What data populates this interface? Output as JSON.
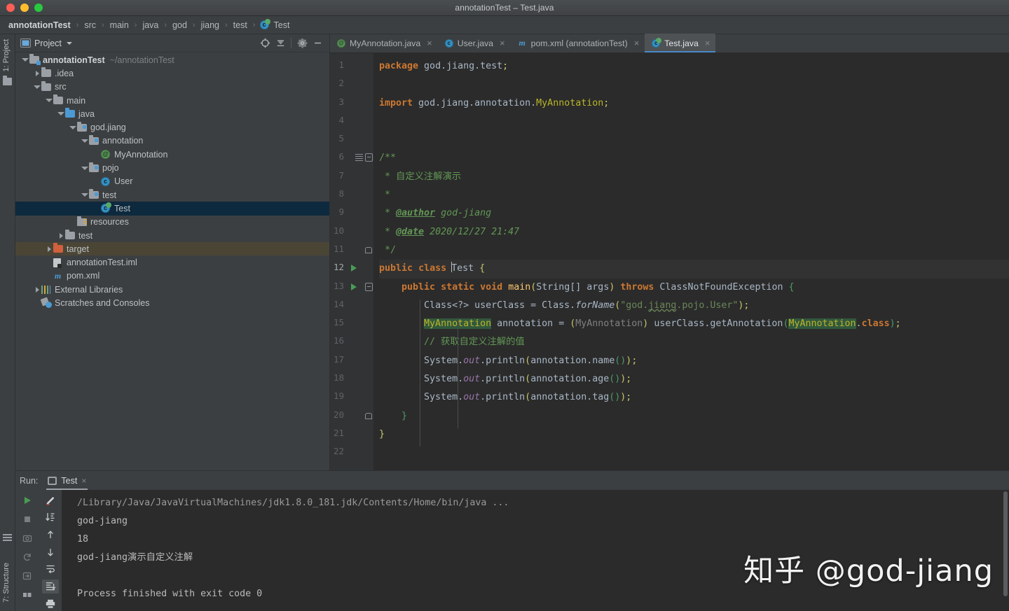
{
  "window": {
    "title": "annotationTest – Test.java",
    "traffic_lights": [
      "close",
      "minimize",
      "zoom"
    ]
  },
  "breadcrumb": {
    "separator": "›",
    "items": [
      {
        "label": "annotationTest",
        "icon": null
      },
      {
        "label": "src",
        "icon": null
      },
      {
        "label": "main",
        "icon": null
      },
      {
        "label": "java",
        "icon": null
      },
      {
        "label": "god",
        "icon": null
      },
      {
        "label": "jiang",
        "icon": null
      },
      {
        "label": "test",
        "icon": null
      },
      {
        "label": "Test",
        "icon": "java-class-icon"
      }
    ]
  },
  "left_strip": {
    "project_label": "1: Project",
    "structure_label": "7: Structure"
  },
  "project_panel": {
    "title": "Project",
    "toolbar": [
      {
        "name": "select-opened-file-button",
        "icon": "crosshair-target-icon"
      },
      {
        "name": "collapse-all-button",
        "icon": "collapse-all-icon"
      },
      {
        "name": "settings-button",
        "icon": "gear-icon"
      },
      {
        "name": "hide-button",
        "icon": "minus-icon"
      }
    ],
    "tree": [
      {
        "label": "annotationTest",
        "sub": "~/annotationTest",
        "depth": 0,
        "arrow": "open",
        "icon": "module-folder-icon",
        "bold": true,
        "state": "normal"
      },
      {
        "label": ".idea",
        "sub": "",
        "depth": 1,
        "arrow": "closed",
        "icon": "folder-icon",
        "bold": false,
        "state": "normal"
      },
      {
        "label": "src",
        "sub": "",
        "depth": 1,
        "arrow": "open",
        "icon": "folder-icon",
        "bold": false,
        "state": "normal"
      },
      {
        "label": "main",
        "sub": "",
        "depth": 2,
        "arrow": "open",
        "icon": "folder-icon",
        "bold": false,
        "state": "normal"
      },
      {
        "label": "java",
        "sub": "",
        "depth": 3,
        "arrow": "open",
        "icon": "source-folder-icon",
        "bold": false,
        "state": "normal"
      },
      {
        "label": "god.jiang",
        "sub": "",
        "depth": 4,
        "arrow": "open",
        "icon": "package-icon",
        "bold": false,
        "state": "normal"
      },
      {
        "label": "annotation",
        "sub": "",
        "depth": 5,
        "arrow": "open",
        "icon": "package-icon",
        "bold": false,
        "state": "normal"
      },
      {
        "label": "MyAnnotation",
        "sub": "",
        "depth": 6,
        "arrow": "none",
        "icon": "annotation-class-icon",
        "bold": false,
        "state": "normal"
      },
      {
        "label": "pojo",
        "sub": "",
        "depth": 5,
        "arrow": "open",
        "icon": "package-icon",
        "bold": false,
        "state": "normal"
      },
      {
        "label": "User",
        "sub": "",
        "depth": 6,
        "arrow": "none",
        "icon": "java-class-icon",
        "bold": false,
        "state": "normal"
      },
      {
        "label": "test",
        "sub": "",
        "depth": 5,
        "arrow": "open",
        "icon": "package-icon",
        "bold": false,
        "state": "normal"
      },
      {
        "label": "Test",
        "sub": "",
        "depth": 6,
        "arrow": "none",
        "icon": "runnable-class-icon",
        "bold": false,
        "state": "selected"
      },
      {
        "label": "resources",
        "sub": "",
        "depth": 4,
        "arrow": "none",
        "icon": "resources-folder-icon",
        "bold": false,
        "state": "normal"
      },
      {
        "label": "test",
        "sub": "",
        "depth": 3,
        "arrow": "closed",
        "icon": "folder-icon",
        "bold": false,
        "state": "normal"
      },
      {
        "label": "target",
        "sub": "",
        "depth": 2,
        "arrow": "closed",
        "icon": "excluded-folder-icon",
        "bold": false,
        "state": "excluded"
      },
      {
        "label": "annotationTest.iml",
        "sub": "",
        "depth": 2,
        "arrow": "none",
        "icon": "iml-file-icon",
        "bold": false,
        "state": "normal"
      },
      {
        "label": "pom.xml",
        "sub": "",
        "depth": 2,
        "arrow": "none",
        "icon": "maven-file-icon",
        "bold": false,
        "state": "normal"
      },
      {
        "label": "External Libraries",
        "sub": "",
        "depth": 1,
        "arrow": "closed",
        "icon": "libraries-icon",
        "bold": false,
        "state": "normal"
      },
      {
        "label": "Scratches and Consoles",
        "sub": "",
        "depth": 1,
        "arrow": "none",
        "icon": "scratches-icon",
        "bold": false,
        "state": "normal"
      }
    ]
  },
  "editor": {
    "tabs": [
      {
        "label": "MyAnnotation.java",
        "icon": "annotation-class-icon",
        "active": false,
        "close": "×"
      },
      {
        "label": "User.java",
        "icon": "java-class-icon",
        "active": false,
        "close": "×"
      },
      {
        "label": "pom.xml (annotationTest)",
        "icon": "maven-file-icon",
        "active": false,
        "close": "×"
      },
      {
        "label": "Test.java",
        "icon": "runnable-class-icon",
        "active": true,
        "close": "×"
      }
    ],
    "line_numbers": [
      "1",
      "2",
      "3",
      "4",
      "5",
      "6",
      "7",
      "8",
      "9",
      "10",
      "11",
      "12",
      "13",
      "14",
      "15",
      "16",
      "17",
      "18",
      "19",
      "20",
      "21",
      "22"
    ],
    "current_line": 12,
    "gutter_marks": {
      "6": [
        "doc-mark",
        "fold-open"
      ],
      "11": [
        "fold-end"
      ],
      "12": [
        "run-marker"
      ],
      "13": [
        "run-marker",
        "fold-open"
      ],
      "20": [
        "fold-end"
      ]
    },
    "lines": [
      "package god.jiang.test;",
      "",
      "import god.jiang.annotation.MyAnnotation;",
      "",
      "",
      "/**",
      " * 自定义注解演示",
      " *",
      " * @author god-jiang",
      " * @date 2020/12/27 21:47",
      " */",
      "public class Test {",
      "    public static void main(String[] args) throws ClassNotFoundException {",
      "        Class<?> userClass = Class.forName(\"god.jiang.pojo.User\");",
      "        MyAnnotation annotation = (MyAnnotation) userClass.getAnnotation(MyAnnotation.class);",
      "        // 获取自定义注解的值",
      "        System.out.println(annotation.name());",
      "        System.out.println(annotation.age());",
      "        System.out.println(annotation.tag());",
      "    }",
      "}",
      ""
    ]
  },
  "run_panel": {
    "label": "Run:",
    "tab_label": "Test",
    "tab_close": "×",
    "left_tools": [
      {
        "name": "rerun-button",
        "icon": "play-icon"
      },
      {
        "name": "stop-button",
        "icon": "stop-icon"
      },
      {
        "name": "screenshot-button",
        "icon": "camera-icon"
      },
      {
        "name": "restart-button",
        "icon": "rerun-icon"
      },
      {
        "name": "export-button",
        "icon": "export-icon"
      },
      {
        "name": "layout-button",
        "icon": "layout-icon"
      }
    ],
    "right_tools": [
      {
        "name": "toggle-soft-wrap-button",
        "icon": "pencil-wrap-icon"
      },
      {
        "name": "scroll-to-end-button",
        "icon": "scroll-down-icon"
      },
      {
        "name": "up-button",
        "icon": "arrow-up-icon"
      },
      {
        "name": "down-button",
        "icon": "arrow-down-icon"
      },
      {
        "name": "soft-wrap-button",
        "icon": "wrap-icon"
      },
      {
        "name": "scroll-to-end-toggle",
        "icon": "scroll-end-icon"
      },
      {
        "name": "print-button",
        "icon": "printer-icon"
      }
    ],
    "output": [
      {
        "text": "/Library/Java/JavaVirtualMachines/jdk1.8.0_181.jdk/Contents/Home/bin/java ...",
        "style": "path"
      },
      {
        "text": "god-jiang",
        "style": "normal"
      },
      {
        "text": "18",
        "style": "normal"
      },
      {
        "text": "god-jiang演示自定义注解",
        "style": "normal"
      },
      {
        "text": "",
        "style": "normal"
      },
      {
        "text": "Process finished with exit code 0",
        "style": "normal"
      }
    ]
  },
  "watermark": {
    "text": "知乎 @god-jiang"
  },
  "colors": {
    "background": "#3c3f41",
    "editor_background": "#2b2b2b",
    "gutter_background": "#313335",
    "selection": "#0d293e",
    "excluded": "#4b4536",
    "keyword": "#cc7832",
    "string": "#6a8759",
    "comment": "#629755",
    "annotation": "#bbb529",
    "static_field": "#9876aa",
    "accent_tab": "#4a88c7",
    "run_green": "#499c54"
  }
}
